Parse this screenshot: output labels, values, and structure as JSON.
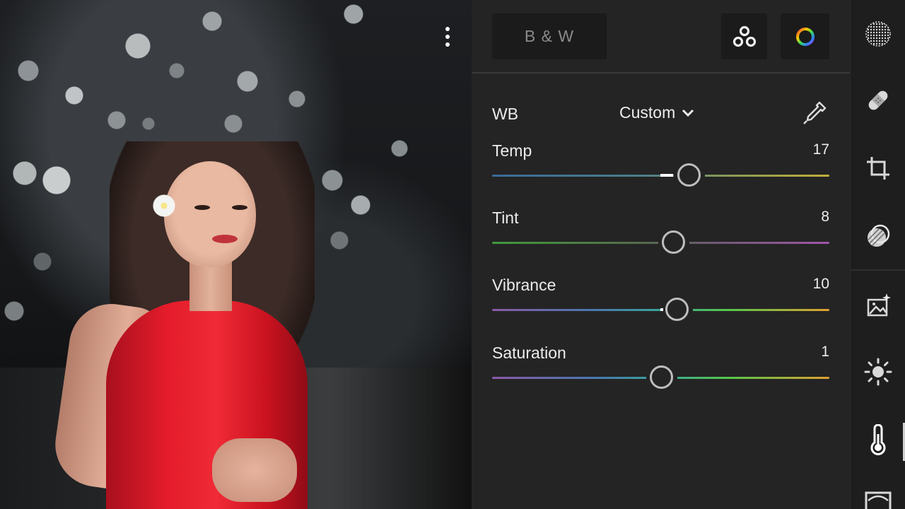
{
  "photo": {
    "more_menu_icon": "vertical-dots-icon"
  },
  "panel": {
    "bw_button_label": "B & W",
    "profiles_icon": "profiles-circles-icon",
    "color_mix_icon": "color-wheel-icon",
    "white_balance": {
      "label": "WB",
      "value": "Custom",
      "eyedropper_icon": "eyedropper-icon"
    },
    "sliders": [
      {
        "label": "Temp",
        "value": "17",
        "position": 0.585
      },
      {
        "label": "Tint",
        "value": "8",
        "position": 0.54
      },
      {
        "label": "Vibrance",
        "value": "10",
        "position": 0.55
      },
      {
        "label": "Saturation",
        "value": "1",
        "position": 0.505
      }
    ],
    "colors": {
      "panel_bg": "#242424",
      "temp_track": [
        "#3a6c9a",
        "#c7b23a"
      ],
      "tint_track": [
        "#3f9a3a",
        "#a055a7"
      ],
      "vibrance_track": [
        "#8a5aa8",
        "#e0a030"
      ],
      "saturation_track": [
        "#8a5aa8",
        "#e0a030"
      ]
    }
  },
  "rail": {
    "tools": [
      "presets-icon",
      "healing-icon",
      "crop-icon",
      "masking-icon",
      "auto-enhance-icon",
      "light-icon",
      "color-temperature-icon",
      "effects-icon"
    ],
    "active_tool": "color-temperature-icon"
  }
}
